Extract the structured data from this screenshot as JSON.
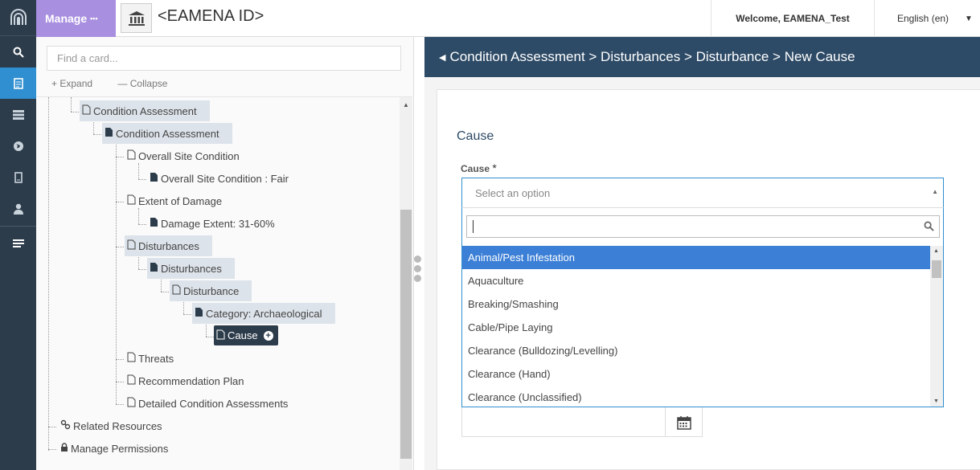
{
  "topbar": {
    "manage_label": "Manage",
    "manage_dots": "•••",
    "record_title": "<EAMENA ID>",
    "welcome": "Welcome, EAMENA_Test",
    "language": "English (en)"
  },
  "sidebar_icons": [
    "archway-logo-icon",
    "search-icon",
    "resource-editor-icon",
    "list-icon",
    "globe-icon",
    "mobile-icon",
    "user-icon",
    "menu-lines-icon"
  ],
  "tree": {
    "search_placeholder": "Find a card...",
    "expand_label": "Expand",
    "collapse_label": "Collapse",
    "nodes": [
      {
        "label": "Condition Assessment"
      },
      {
        "label": "Condition Assessment"
      },
      {
        "label": "Overall Site Condition"
      },
      {
        "label": "Overall Site Condition : Fair"
      },
      {
        "label": "Extent of Damage"
      },
      {
        "label": "Damage Extent: 31-60%"
      },
      {
        "label": "Disturbances"
      },
      {
        "label": "Disturbances"
      },
      {
        "label": "Disturbance"
      },
      {
        "label": "Category: Archaeological"
      },
      {
        "label": "Cause"
      },
      {
        "label": "Threats"
      },
      {
        "label": "Recommendation Plan"
      },
      {
        "label": "Detailed Condition Assessments"
      },
      {
        "label": "Related Resources"
      },
      {
        "label": "Manage Permissions"
      }
    ]
  },
  "breadcrumb": "Condition Assessment > Disturbances > Disturbance > New Cause",
  "form": {
    "card_title": "Cause",
    "field_label": "Cause",
    "required_mark": "*",
    "select_placeholder": "Select an option",
    "options": [
      "Animal/Pest Infestation",
      "Aquaculture",
      "Breaking/Smashing",
      "Cable/Pipe Laying",
      "Clearance (Bulldozing/Levelling)",
      "Clearance (Hand)",
      "Clearance (Unclassified)"
    ],
    "highlighted_option": "Animal/Pest Infestation"
  },
  "colors": {
    "rail": "#2d3c4b",
    "manage": "#a88fe0",
    "header_bar": "#2d4a66",
    "accent": "#2f8fd0",
    "option_highlight": "#3b7fd6"
  }
}
